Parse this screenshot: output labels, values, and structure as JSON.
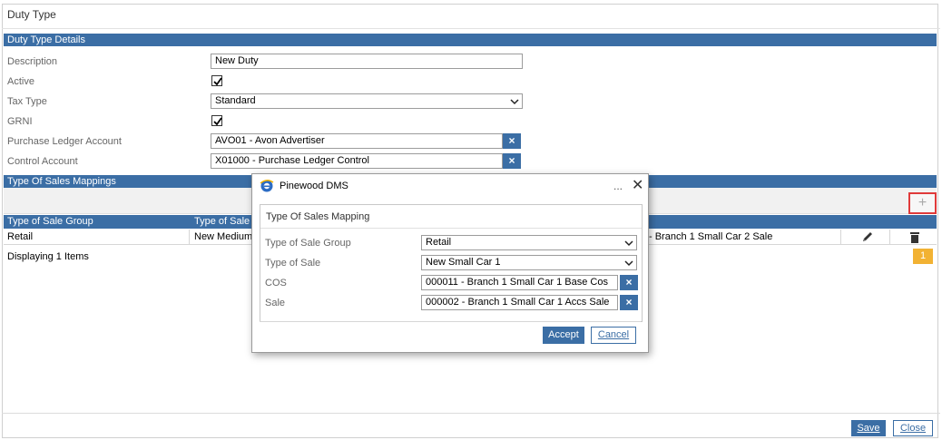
{
  "page": {
    "title": "Duty Type"
  },
  "details": {
    "header": "Duty Type Details",
    "description_label": "Description",
    "description_value": "New Duty",
    "active_label": "Active",
    "tax_type_label": "Tax Type",
    "tax_type_value": "Standard",
    "grni_label": "GRNI",
    "purchase_ledger_label": "Purchase Ledger Account",
    "purchase_ledger_value": "AVO01 - Avon Advertiser",
    "control_account_label": "Control Account",
    "control_account_value": "X01000 - Purchase Ledger Control",
    "clear_symbol": "×"
  },
  "mappings": {
    "header": "Type Of Sales Mappings",
    "add_symbol": "+",
    "columns": [
      "Type of Sale Group",
      "Type of Sale"
    ],
    "rows": [
      {
        "group": "Retail",
        "type_of_sale": "New Medium",
        "sale": "- Branch 1 Small Car 2 Sale"
      }
    ],
    "footer": "Displaying 1 Items",
    "page_number": "1"
  },
  "footer": {
    "save_label": "Save",
    "close_label": "Close"
  },
  "dialog": {
    "title": "Pinewood DMS",
    "ellipsis": "...",
    "close_symbol": "✕",
    "panel_title": "Type Of Sales Mapping",
    "fields": [
      {
        "label": "Type of Sale Group",
        "value": "Retail"
      },
      {
        "label": "Type of Sale",
        "value": "New Small Car 1"
      },
      {
        "label": "COS",
        "value": "000011 - Branch 1 Small Car 1 Base Cos"
      },
      {
        "label": "Sale",
        "value": "000002 - Branch 1 Small Car 1 Accs Sale"
      }
    ],
    "accept_label": "Accept",
    "cancel_label": "Cancel"
  },
  "colors": {
    "accent": "#3b6ea5",
    "highlight": "#e03a3a",
    "badge": "#f2b233"
  }
}
